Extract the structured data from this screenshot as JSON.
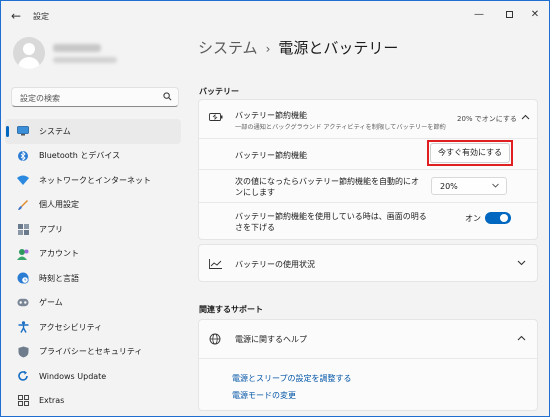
{
  "window": {
    "title": "設定",
    "controls": {
      "minimize": "—",
      "maximize": "□",
      "close": "✕"
    }
  },
  "sidebar": {
    "search_placeholder": "設定の検索",
    "items": [
      {
        "label": "システム",
        "icon": "monitor-icon",
        "active": true
      },
      {
        "label": "Bluetooth とデバイス",
        "icon": "bluetooth-icon"
      },
      {
        "label": "ネットワークとインターネット",
        "icon": "wifi-icon"
      },
      {
        "label": "個人用設定",
        "icon": "brush-icon"
      },
      {
        "label": "アプリ",
        "icon": "apps-icon"
      },
      {
        "label": "アカウント",
        "icon": "account-icon"
      },
      {
        "label": "時刻と言語",
        "icon": "globe-clock-icon"
      },
      {
        "label": "ゲーム",
        "icon": "gamepad-icon"
      },
      {
        "label": "アクセシビリティ",
        "icon": "accessibility-icon"
      },
      {
        "label": "プライバシーとセキュリティ",
        "icon": "shield-icon"
      },
      {
        "label": "Windows Update",
        "icon": "update-icon"
      },
      {
        "label": "Extras",
        "icon": "extras-icon"
      }
    ]
  },
  "breadcrumb": {
    "parent": "システム",
    "separator": "›",
    "current": "電源とバッテリー"
  },
  "battery_section": {
    "heading": "バッテリー",
    "saver": {
      "title": "バッテリー節約機能",
      "subtitle": "一部の通知とバックグラウンド アクティビティを制限してバッテリーを節約",
      "status": "20% でオンにする",
      "toggle_row_label": "バッテリー節約機能",
      "activate_button": "今すぐ有効にする",
      "threshold_label": "次の値になったらバッテリー節約機能を自動的にオンにします",
      "threshold_value": "20%",
      "dim_label_line1": "バッテリー節約機能を使用している時は、画面の明る",
      "dim_label_line2": "さを下げる",
      "dim_state": "オン",
      "dim_on": true
    },
    "usage": {
      "title": "バッテリーの使用状況"
    }
  },
  "related": {
    "heading": "関連するサポート",
    "help_title": "電源に関するヘルプ",
    "links": [
      "電源とスリープの設定を調整する",
      "電源モードの変更"
    ]
  },
  "colors": {
    "accent": "#0067c0",
    "highlight": "#e02020"
  }
}
